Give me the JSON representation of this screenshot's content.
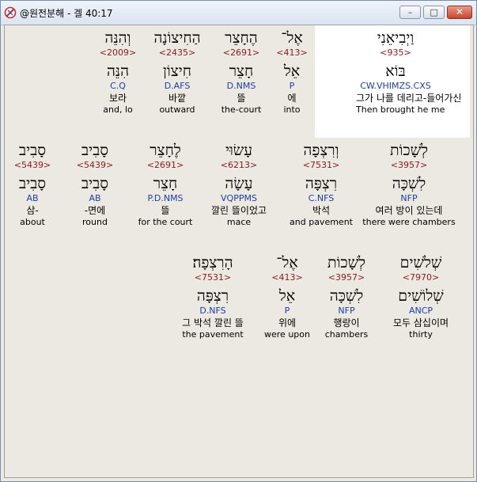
{
  "window": {
    "title": "@원전분해 - 겔 40:17"
  },
  "controls": {
    "minimize": "–",
    "maximize": "□",
    "close": "✕"
  },
  "rows": [
    [
      {
        "heb": "וַיְבִיאֵנִי",
        "strong": "<935>",
        "lemma": "בּוֹא",
        "morph": "CW.VHIMZS.CXS",
        "kor": "그가 나를 데리고-들어가신",
        "eng": "Then brought he me"
      },
      {
        "heb": "אֶל־",
        "strong": "<413>",
        "lemma": "אֵל",
        "morph": "P",
        "kor": "에",
        "eng": "into"
      },
      {
        "heb": "הֶחָצֵר",
        "strong": "<2691>",
        "lemma": "חָצֵר",
        "morph": "D.NMS",
        "kor": "뜰",
        "eng": "the-court"
      },
      {
        "heb": "הַחִיצוֹנָה",
        "strong": "<2435>",
        "lemma": "חִיצוֹן",
        "morph": "D.AFS",
        "kor": "바깥",
        "eng": "outward"
      },
      {
        "heb": "וְהִנֵּה",
        "strong": "<2009>",
        "lemma": "הִנֵּה",
        "morph": "C.Q",
        "kor": "보라",
        "eng": "and, lo"
      }
    ],
    [
      {
        "heb": "לְשָׁכוֹת",
        "strong": "<3957>",
        "lemma": "לִשְׁכָּה",
        "morph": "NFP",
        "kor": "여러 방이 있는데",
        "eng": "there were chambers"
      },
      {
        "heb": "וְרִצְפָה",
        "strong": "<7531>",
        "lemma": "רִצְפָּה",
        "morph": "C.NFS",
        "kor": "박석",
        "eng": "and pavement"
      },
      {
        "heb": "עָשׂוּי",
        "strong": "<6213>",
        "lemma": "עָשָׂה",
        "morph": "VQPPMS",
        "kor": "깔린 뜰이었고",
        "eng": "mace"
      },
      {
        "heb": "לֶחָצֵר",
        "strong": "<2691>",
        "lemma": "חָצֵר",
        "morph": "P.D.NMS",
        "kor": "뜰",
        "eng": "for the court"
      },
      {
        "heb": "סָבִיב",
        "strong": "<5439>",
        "lemma": "סָבִיב",
        "morph": "AB",
        "kor": "-면에",
        "eng": "round"
      },
      {
        "heb": "סָבִיב",
        "strong": "<5439>",
        "lemma": "סָבִיב",
        "morph": "AB",
        "kor": "삼-",
        "eng": "about"
      }
    ],
    [
      {
        "heb": "שְׁלֹשִׁים",
        "strong": "<7970>",
        "lemma": "שְׁלוֹשִׁים",
        "morph": "ANCP",
        "kor": "모두 삼십이며",
        "eng": "thirty"
      },
      {
        "heb": "לְשָׁכוֹת",
        "strong": "<3957>",
        "lemma": "לִשְׁכָּה",
        "morph": "NFP",
        "kor": "행랑이",
        "eng": "chambers"
      },
      {
        "heb": "אֶל־",
        "strong": "<413>",
        "lemma": "אֵל",
        "morph": "P",
        "kor": "위에",
        "eng": "were upon"
      },
      {
        "heb": "הָרִצְפָה׃",
        "strong": "<7531>",
        "lemma": "רִצְפָּה",
        "morph": "D.NFS",
        "kor": "그 박석 깔린 뜰",
        "eng": "the pavement"
      }
    ]
  ]
}
